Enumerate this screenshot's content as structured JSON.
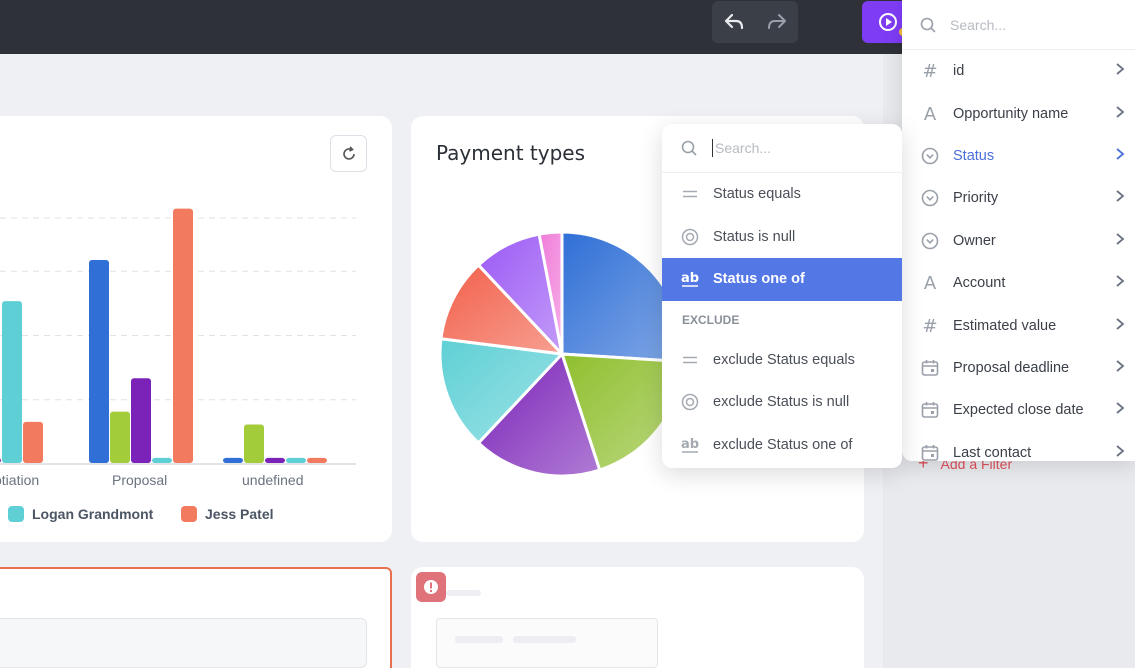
{
  "toolbar": {
    "undo_icon": "undo-icon",
    "redo_icon": "redo-icon",
    "run_icon": "play-circle-icon"
  },
  "bar_card": {
    "tick_labels": [
      "otiation",
      "Proposal",
      "undefined"
    ],
    "legend": [
      {
        "name": "Logan Grandmont",
        "color": "#5ed0d5"
      },
      {
        "name": "Jess Patel",
        "color": "#f27a5e"
      }
    ]
  },
  "chart_data": [
    {
      "type": "bar",
      "categories": [
        "otiation",
        "Proposal",
        "undefined"
      ],
      "ylim": [
        0,
        100
      ],
      "grid": true,
      "series": [
        {
          "color": "#2f6fd6",
          "values": [
            null,
            79,
            2
          ]
        },
        {
          "color": "#a3cc3a",
          "values": [
            null,
            20,
            15
          ]
        },
        {
          "color": "#7b23b8",
          "values": [
            2,
            33,
            2
          ]
        },
        {
          "name": "Logan Grandmont",
          "color": "#5ed0d5",
          "values": [
            63,
            2,
            2
          ]
        },
        {
          "name": "Jess Patel",
          "color": "#f27a5e",
          "values": [
            16,
            99,
            2
          ]
        }
      ]
    },
    {
      "type": "pie",
      "title": "Payment types",
      "slices": [
        {
          "value": 26,
          "color": "#2f6fd6"
        },
        {
          "value": 19,
          "color": "#8fbf2e"
        },
        {
          "value": 17,
          "color": "#7b23b8"
        },
        {
          "value": 15,
          "color": "#5ed0d5"
        },
        {
          "value": 11,
          "color": "#f2604a"
        },
        {
          "value": 9,
          "color": "#9b59f5"
        },
        {
          "value": 3,
          "color": "#f07ad8"
        }
      ]
    }
  ],
  "pie_card": {
    "title": "Payment types"
  },
  "field_dropdown": {
    "search_placeholder": "Search...",
    "items": [
      {
        "label": "id",
        "icon": "hash-icon"
      },
      {
        "label": "Opportunity name",
        "icon": "text-icon"
      },
      {
        "label": "Status",
        "icon": "select-icon",
        "active": true
      },
      {
        "label": "Priority",
        "icon": "select-icon"
      },
      {
        "label": "Owner",
        "icon": "select-icon"
      },
      {
        "label": "Account",
        "icon": "text-icon"
      },
      {
        "label": "Estimated value",
        "icon": "hash-icon"
      },
      {
        "label": "Proposal deadline",
        "icon": "calendar-icon"
      },
      {
        "label": "Expected close date",
        "icon": "calendar-icon"
      },
      {
        "label": "Last contact",
        "icon": "calendar-icon"
      }
    ]
  },
  "operator_dropdown": {
    "search_placeholder": "Search...",
    "include": [
      {
        "label": "Status equals",
        "icon": "equals-icon"
      },
      {
        "label": "Status is null",
        "icon": "null-icon"
      },
      {
        "label": "Status one of",
        "icon": "ab-icon",
        "selected": true
      }
    ],
    "exclude_header": "EXCLUDE",
    "exclude": [
      {
        "label": "exclude Status equals",
        "icon": "equals-icon"
      },
      {
        "label": "exclude Status is null",
        "icon": "null-icon"
      },
      {
        "label": "exclude Status one of",
        "icon": "ab-icon"
      }
    ]
  },
  "add_filter": {
    "label": "Add a Filter"
  },
  "colors": {
    "accent": "#5477e6",
    "run_button": "#7f3cf5",
    "warning": "#e0727a"
  }
}
